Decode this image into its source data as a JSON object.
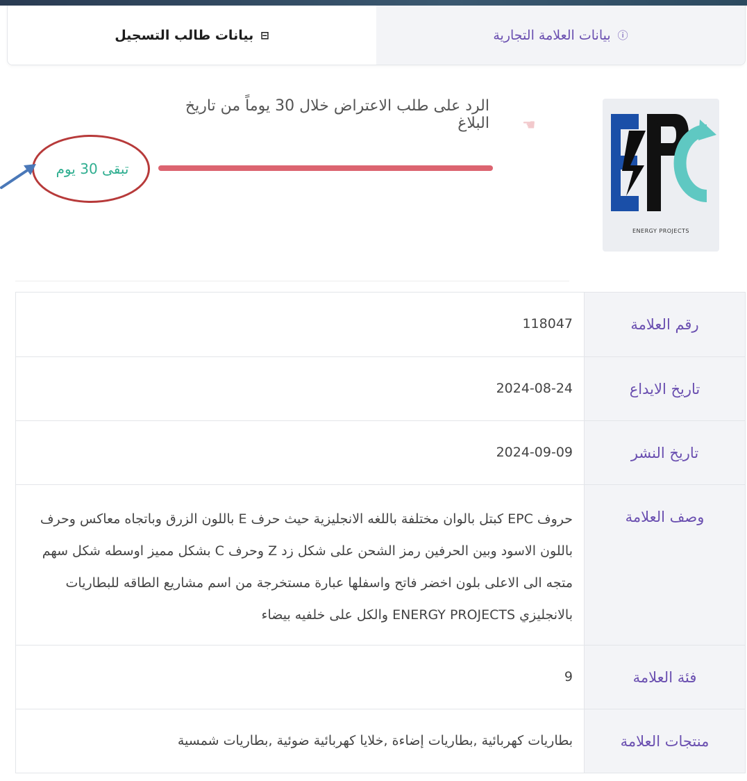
{
  "tabs": [
    {
      "label": "بيانات طالب التسجيل",
      "icon": "id-card-icon",
      "icon_glyph": "⊟",
      "active": true
    },
    {
      "label": "بيانات العلامة التجارية",
      "icon": "info-circle-icon",
      "icon_glyph": "ⓘ",
      "active": false
    }
  ],
  "logo": {
    "letters": "EPC",
    "caption": "ENERGY PROJECTS"
  },
  "notice": {
    "text": "الرد على طلب الاعتراض خلال 30 يوماً من تاريخ البلاغ",
    "remaining": "تبقى 30 يوم",
    "progress": 1.0
  },
  "fields": [
    {
      "label": "رقم العلامة",
      "value": "118047"
    },
    {
      "label": "تاريخ الايداع",
      "value": "2024-08-24"
    },
    {
      "label": "تاريخ النشر",
      "value": "2024-09-09"
    },
    {
      "label": "وصف العلامة",
      "value": "حروف EPC كبتل بالوان مختلفة باللغه الانجليزية حيث حرف E باللون الزرق وباتجاه معاكس وحرف باللون الاسود وبين الحرفين رمز الشحن على شكل زد Z وحرف C بشكل مميز اوسطه شكل سهم متجه الى الاعلى بلون اخضر فاتح واسفلها عبارة مستخرجة من اسم مشاريع الطاقه للبطاريات بالانجليزي ENERGY PROJECTS والكل على خلفيه بيضاء"
    },
    {
      "label": "فئة العلامة",
      "value": "9"
    },
    {
      "label": "منتجات العلامة",
      "value": "بطاريات كهربائية ,بطاريات إضاءة ,خلايا كهربائية ضوئية ,بطاريات شمسية"
    }
  ],
  "colors": {
    "accent": "#6a4fb0",
    "progress": "#dc6470",
    "remaining": "#2fae90",
    "annotation": "#b73a3a"
  }
}
